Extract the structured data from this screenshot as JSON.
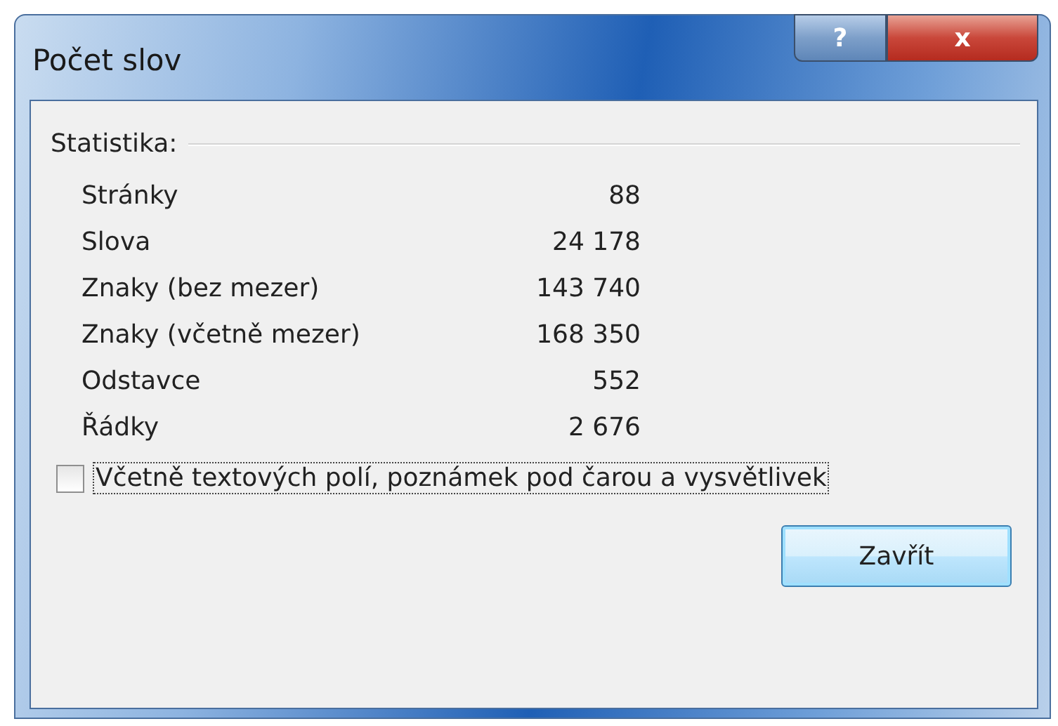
{
  "window": {
    "title": "Počet slov",
    "help_button": "?",
    "close_button": "x"
  },
  "statistics": {
    "heading": "Statistika:",
    "rows": [
      {
        "label": "Stránky",
        "value": "88"
      },
      {
        "label": "Slova",
        "value": "24 178"
      },
      {
        "label": "Znaky (bez mezer)",
        "value": "143 740"
      },
      {
        "label": "Znaky (včetně mezer)",
        "value": "168 350"
      },
      {
        "label": "Odstavce",
        "value": "552"
      },
      {
        "label": "Řádky",
        "value": "2 676"
      }
    ]
  },
  "include_checkbox": {
    "label": "Včetně textových polí, poznámek pod čarou a vysvětlivek",
    "checked": false
  },
  "buttons": [
    "Zavřít"
  ]
}
